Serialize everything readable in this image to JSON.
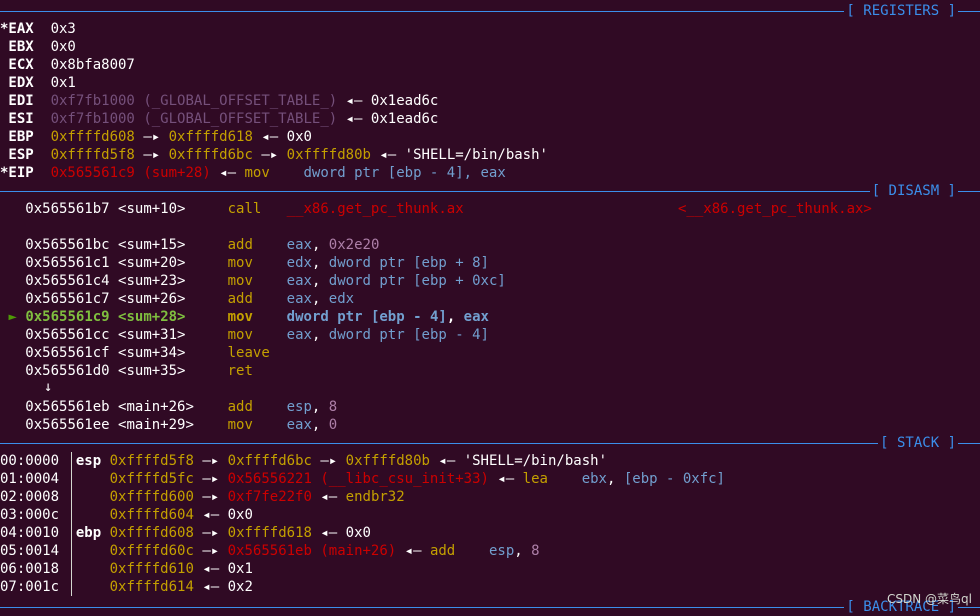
{
  "sections": {
    "registers": "[ REGISTERS ]",
    "disasm": "[ DISASM ]",
    "stack": "[ STACK ]",
    "backtrace": "[ BACKTRACE ]"
  },
  "registers": [
    {
      "name": "*EAX",
      "value": "0x3"
    },
    {
      "name": " EBX",
      "value": "0x0"
    },
    {
      "name": " ECX",
      "value": "0x8bfa8007"
    },
    {
      "name": " EDX",
      "value": "0x1"
    },
    {
      "name": " EDI",
      "value": "0xf7fb1000",
      "sym": "(_GLOBAL_OFFSET_TABLE_)",
      "arrow": "◂—",
      "tail": "0x1ead6c"
    },
    {
      "name": " ESI",
      "value": "0xf7fb1000",
      "sym": "(_GLOBAL_OFFSET_TABLE_)",
      "arrow": "◂—",
      "tail": "0x1ead6c"
    },
    {
      "name": " EBP",
      "value": "0xffffd608",
      "a1": "—▸",
      "v2": "0xffffd618",
      "arrow": "◂—",
      "tail": "0x0"
    },
    {
      "name": " ESP",
      "value": "0xffffd5f8",
      "a1": "—▸",
      "v2": "0xffffd6bc",
      "a2": "—▸",
      "v3": "0xffffd80b",
      "arrow": "◂—",
      "tail": "'SHELL=/bin/bash'"
    },
    {
      "name": "*EIP",
      "value": "0x565561c9",
      "sym": "(sum+28)",
      "arrow": "◂—",
      "mnem": "mov",
      "ops": "dword ptr [ebp - 4], eax"
    }
  ],
  "disasm": [
    {
      "addr": "0x565561b7",
      "sym": "<sum+10>",
      "mnem": "call",
      "ops": "__x86.get_pc_thunk.ax",
      "target": "<__x86.get_pc_thunk.ax>"
    },
    {
      "addr": "0x565561bc",
      "sym": "<sum+15>",
      "mnem": "add",
      "ops1": "eax",
      "ops2": "0x2e20"
    },
    {
      "addr": "0x565561c1",
      "sym": "<sum+20>",
      "mnem": "mov",
      "ops1": "edx",
      "ops2": "dword ptr [ebp + 8]"
    },
    {
      "addr": "0x565561c4",
      "sym": "<sum+23>",
      "mnem": "mov",
      "ops1": "eax",
      "ops2": "dword ptr [ebp + 0xc]"
    },
    {
      "addr": "0x565561c7",
      "sym": "<sum+26>",
      "mnem": "add",
      "ops1": "eax",
      "ops2": "edx"
    },
    {
      "addr": "0x565561c9",
      "sym": "<sum+28>",
      "mnem": "mov",
      "ops1": "dword ptr [ebp - 4]",
      "ops2": "eax",
      "current": true,
      "marker": "►"
    },
    {
      "addr": "0x565561cc",
      "sym": "<sum+31>",
      "mnem": "mov",
      "ops1": "eax",
      "ops2": "dword ptr [ebp - 4]"
    },
    {
      "addr": "0x565561cf",
      "sym": "<sum+34>",
      "mnem": "leave"
    },
    {
      "addr": "0x565561d0",
      "sym": "<sum+35>",
      "mnem": "ret"
    },
    {
      "addr": "0x565561eb",
      "sym": "<main+26>",
      "mnem": "add",
      "ops1": "esp",
      "ops2": "8"
    },
    {
      "addr": "0x565561ee",
      "sym": "<main+29>",
      "mnem": "mov",
      "ops1": "eax",
      "ops2": "0"
    }
  ],
  "jump_arrow": "↓",
  "stack": [
    {
      "off": "00:0000",
      "reg": "esp",
      "v1": "0xffffd5f8",
      "v2": "0xffffd6bc",
      "v3": "0xffffd80b",
      "tail": "'SHELL=/bin/bash'"
    },
    {
      "off": "01:0004",
      "reg": "",
      "v1": "0xffffd5fc",
      "v2": "0x56556221",
      "sym": "(__libc_csu_init+33)",
      "mnem": "lea",
      "ops1": "ebx",
      "ops2": "[ebp - 0xfc]"
    },
    {
      "off": "02:0008",
      "reg": "",
      "v1": "0xffffd600",
      "v2": "0xf7fe22f0",
      "tail": "endbr32"
    },
    {
      "off": "03:000c",
      "reg": "",
      "v1": "0xffffd604",
      "tail": "0x0"
    },
    {
      "off": "04:0010",
      "reg": "ebp",
      "v1": "0xffffd608",
      "v2": "0xffffd618",
      "tail": "0x0"
    },
    {
      "off": "05:0014",
      "reg": "",
      "v1": "0xffffd60c",
      "v2": "0x565561eb",
      "sym": "(main+26)",
      "mnem": "add",
      "ops1": "esp",
      "ops2": "8"
    },
    {
      "off": "06:0018",
      "reg": "",
      "v1": "0xffffd610",
      "tail": "0x1"
    },
    {
      "off": "07:001c",
      "reg": "",
      "v1": "0xffffd614",
      "tail": "0x2"
    }
  ],
  "watermark": "CSDN @菜鸟ql",
  "colors": {
    "background": "#300a24",
    "separator": "#3b8eea",
    "address": "#c4a000",
    "code": "#cc0000",
    "mnemonic": "#c4a000",
    "register": "#729fcf",
    "number": "#ad7fa8"
  }
}
